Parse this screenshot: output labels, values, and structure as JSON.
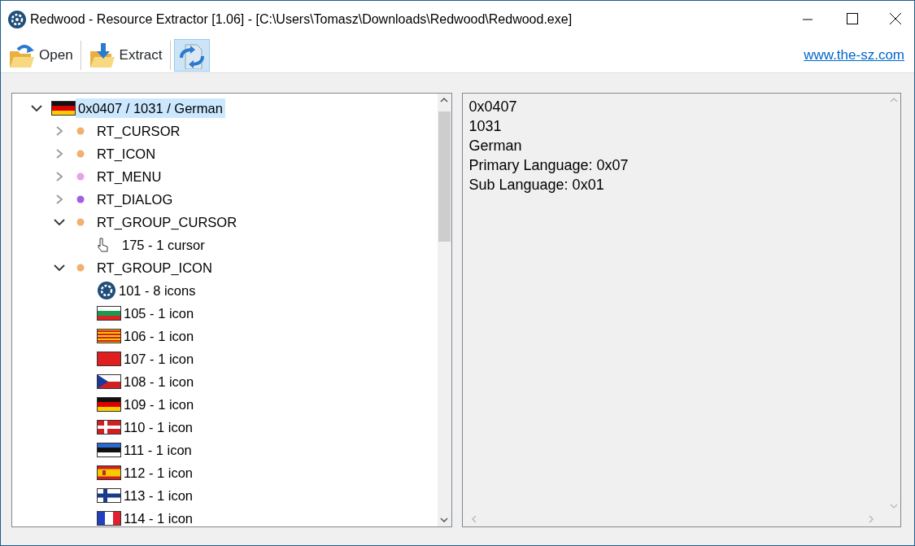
{
  "window": {
    "title": "Redwood - Resource Extractor [1.06] - [C:\\Users\\Tomasz\\Downloads\\Redwood\\Redwood.exe]"
  },
  "toolbar": {
    "buttons": [
      {
        "label": "Open",
        "kind": "open",
        "selected": false
      },
      {
        "label": "Extract",
        "kind": "extract",
        "selected": false
      },
      {
        "kind": "convert",
        "selected": true
      }
    ],
    "link": "www.the-sz.com"
  },
  "tree": [
    {
      "label": "0x0407 / 1031 / German",
      "expanded": true,
      "selected": true,
      "children": [
        {
          "label": "RT_CURSOR",
          "color": "#f0b070",
          "expanded": false,
          "selected": false
        },
        {
          "label": "RT_ICON",
          "color": "#f0b070",
          "expanded": false,
          "selected": false
        },
        {
          "label": "RT_MENU",
          "color": "#e8a0e8",
          "expanded": false,
          "selected": false
        },
        {
          "label": "RT_DIALOG",
          "color": "#a060e0",
          "expanded": false,
          "selected": false
        },
        {
          "label": "RT_GROUP_CURSOR",
          "color": "#f0b070",
          "expanded": true,
          "selected": false,
          "children": [
            {
              "label": "175 - 1 cursor",
              "selected": false
            }
          ]
        },
        {
          "label": "RT_GROUP_ICON",
          "color": "#f0b070",
          "expanded": true,
          "selected": false,
          "children": [
            {
              "label": "101 - 8 icons",
              "selected": false
            },
            {
              "label": "105 - 1 icon",
              "selected": false
            },
            {
              "label": "106 - 1 icon",
              "selected": false
            },
            {
              "label": "107 - 1 icon",
              "selected": false
            },
            {
              "label": "108 - 1 icon",
              "selected": false
            },
            {
              "label": "109 - 1 icon",
              "selected": false
            },
            {
              "label": "110 - 1 icon",
              "selected": false
            },
            {
              "label": "111 - 1 icon",
              "selected": false
            },
            {
              "label": "112 - 1 icon",
              "selected": false
            },
            {
              "label": "113 - 1 icon",
              "selected": false
            },
            {
              "label": "114 - 1 icon",
              "selected": false
            }
          ]
        }
      ]
    }
  ],
  "details": [
    "0x0407",
    "1031",
    "German",
    "Primary Language: 0x07",
    "Sub Language: 0x01"
  ]
}
